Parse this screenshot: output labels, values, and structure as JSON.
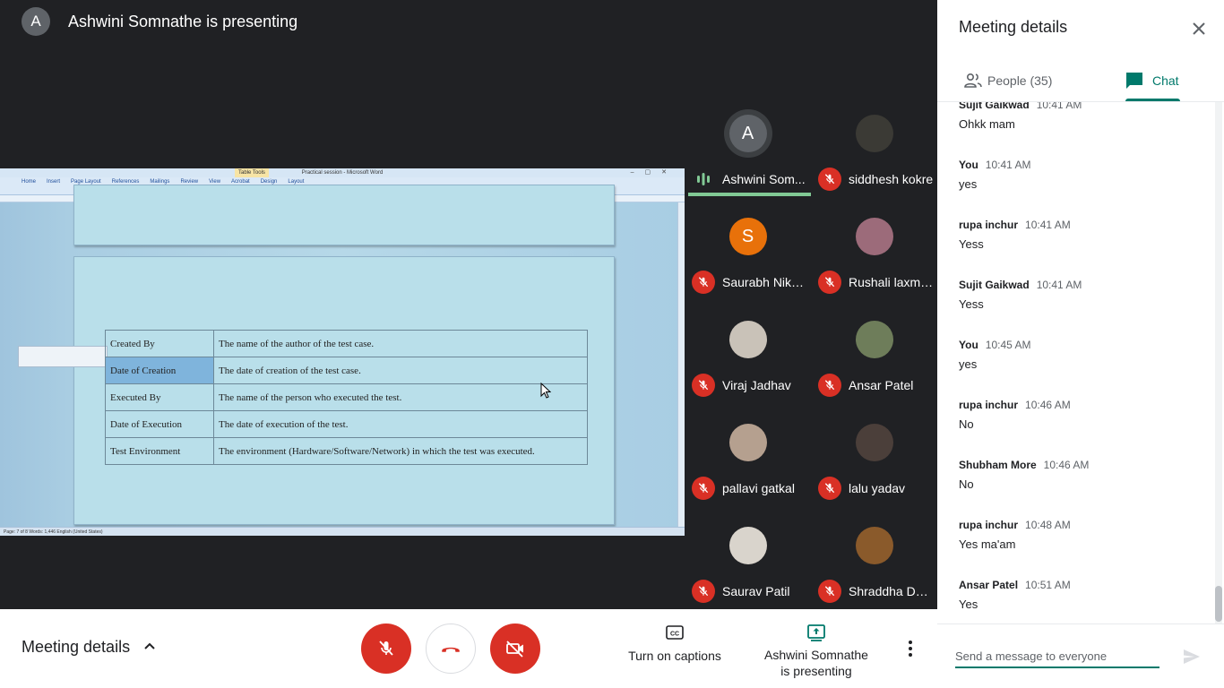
{
  "presenter": {
    "initial": "A",
    "text": "Ashwini Somnathe is presenting"
  },
  "shared_screen": {
    "window_title": "Practical session - Microsoft Word",
    "table_tools": "Table Tools",
    "ribbon_tabs": [
      "Home",
      "Insert",
      "Page Layout",
      "References",
      "Mailings",
      "Review",
      "View",
      "Acrobat",
      "Design",
      "Layout"
    ],
    "table_rows": [
      {
        "field": "Created By",
        "description": "The name of the author of the test case."
      },
      {
        "field": "Date of Creation",
        "description": "The date of creation of the test case."
      },
      {
        "field": "Executed By",
        "description": "The name of the person who executed the test."
      },
      {
        "field": "Date of Execution",
        "description": "The date of execution of the test."
      },
      {
        "field": "Test Environment",
        "description": "The environment (Hardware/Software/Network) in which the test was executed."
      }
    ],
    "status_bar": "Page: 7 of 8   Words: 1,446   English (United States)"
  },
  "participants": [
    {
      "name": "Ashwini Som...",
      "initial": "A",
      "avatar_color": "#5f6368",
      "status": "speaking"
    },
    {
      "name": "siddhesh kokre",
      "initial": "",
      "avatar_color": "#3b3a35",
      "status": "muted"
    },
    {
      "name": "Saurabh Nikam",
      "initial": "S",
      "avatar_color": "#e8710a",
      "status": "muted"
    },
    {
      "name": "Rushali laxma...",
      "initial": "",
      "avatar_color": "#9c6b7a",
      "status": "muted"
    },
    {
      "name": "Viraj Jadhav",
      "initial": "",
      "avatar_color": "#c9c2b8",
      "status": "muted"
    },
    {
      "name": "Ansar Patel",
      "initial": "",
      "avatar_color": "#6e7d5a",
      "status": "muted"
    },
    {
      "name": "pallavi gatkal",
      "initial": "",
      "avatar_color": "#b5a08f",
      "status": "muted"
    },
    {
      "name": "lalu yadav",
      "initial": "",
      "avatar_color": "#4b3f3a",
      "status": "muted"
    },
    {
      "name": "Saurav Patil",
      "initial": "",
      "avatar_color": "#d9d4cc",
      "status": "muted"
    },
    {
      "name": "Shraddha Doke",
      "initial": "",
      "avatar_color": "#8a5a2b",
      "status": "muted"
    }
  ],
  "bottom_bar": {
    "meeting_details_label": "Meeting details",
    "captions_label": "Turn on captions",
    "present_label_line1": "Ashwini Somnathe",
    "present_label_line2": "is presenting"
  },
  "side_panel": {
    "title": "Meeting details",
    "tabs": {
      "people": "People (35)",
      "chat": "Chat"
    },
    "messages": [
      {
        "sender": "Sujit Gaikwad",
        "time": "10:41 AM",
        "text": "Ohkk mam"
      },
      {
        "sender": "You",
        "time": "10:41 AM",
        "text": "yes"
      },
      {
        "sender": "rupa inchur",
        "time": "10:41 AM",
        "text": "Yess"
      },
      {
        "sender": "Sujit Gaikwad",
        "time": "10:41 AM",
        "text": "Yess"
      },
      {
        "sender": "You",
        "time": "10:45 AM",
        "text": "yes"
      },
      {
        "sender": "rupa inchur",
        "time": "10:46 AM",
        "text": "No"
      },
      {
        "sender": "Shubham More",
        "time": "10:46 AM",
        "text": "No"
      },
      {
        "sender": "rupa inchur",
        "time": "10:48 AM",
        "text": "Yes ma'am"
      },
      {
        "sender": "Ansar Patel",
        "time": "10:51 AM",
        "text": "Yes"
      }
    ],
    "input_placeholder": "Send a message to everyone"
  },
  "colors": {
    "accent": "#00796b",
    "danger": "#d93025",
    "speaking": "#81c995"
  }
}
